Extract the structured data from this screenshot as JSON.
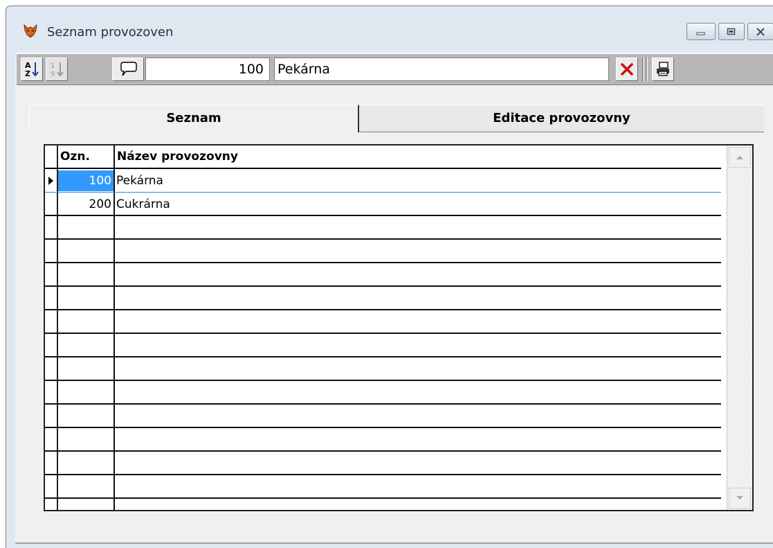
{
  "window": {
    "title": "Seznam provozoven"
  },
  "toolbar": {
    "sort_az_icon": "sort-alpha-asc-icon",
    "sort_num_icon": "sort-numeric-asc-icon",
    "comment_icon": "speech-bubble-icon",
    "code_value": "100",
    "name_value": "Pekárna",
    "delete_icon": "red-x-icon",
    "print_icon": "printer-icon"
  },
  "tabs": [
    {
      "label": "Seznam",
      "active": true
    },
    {
      "label": "Editace provozovny",
      "active": false
    }
  ],
  "grid": {
    "columns": [
      "Ozn.",
      "Název provozovny"
    ],
    "rows": [
      {
        "code": "100",
        "name": "Pekárna",
        "current": true
      },
      {
        "code": "200",
        "name": "Cukrárna",
        "current": false
      }
    ],
    "empty_rows": 12
  },
  "colors": {
    "selection": "#3399ff",
    "delete_red": "#cc1010"
  }
}
